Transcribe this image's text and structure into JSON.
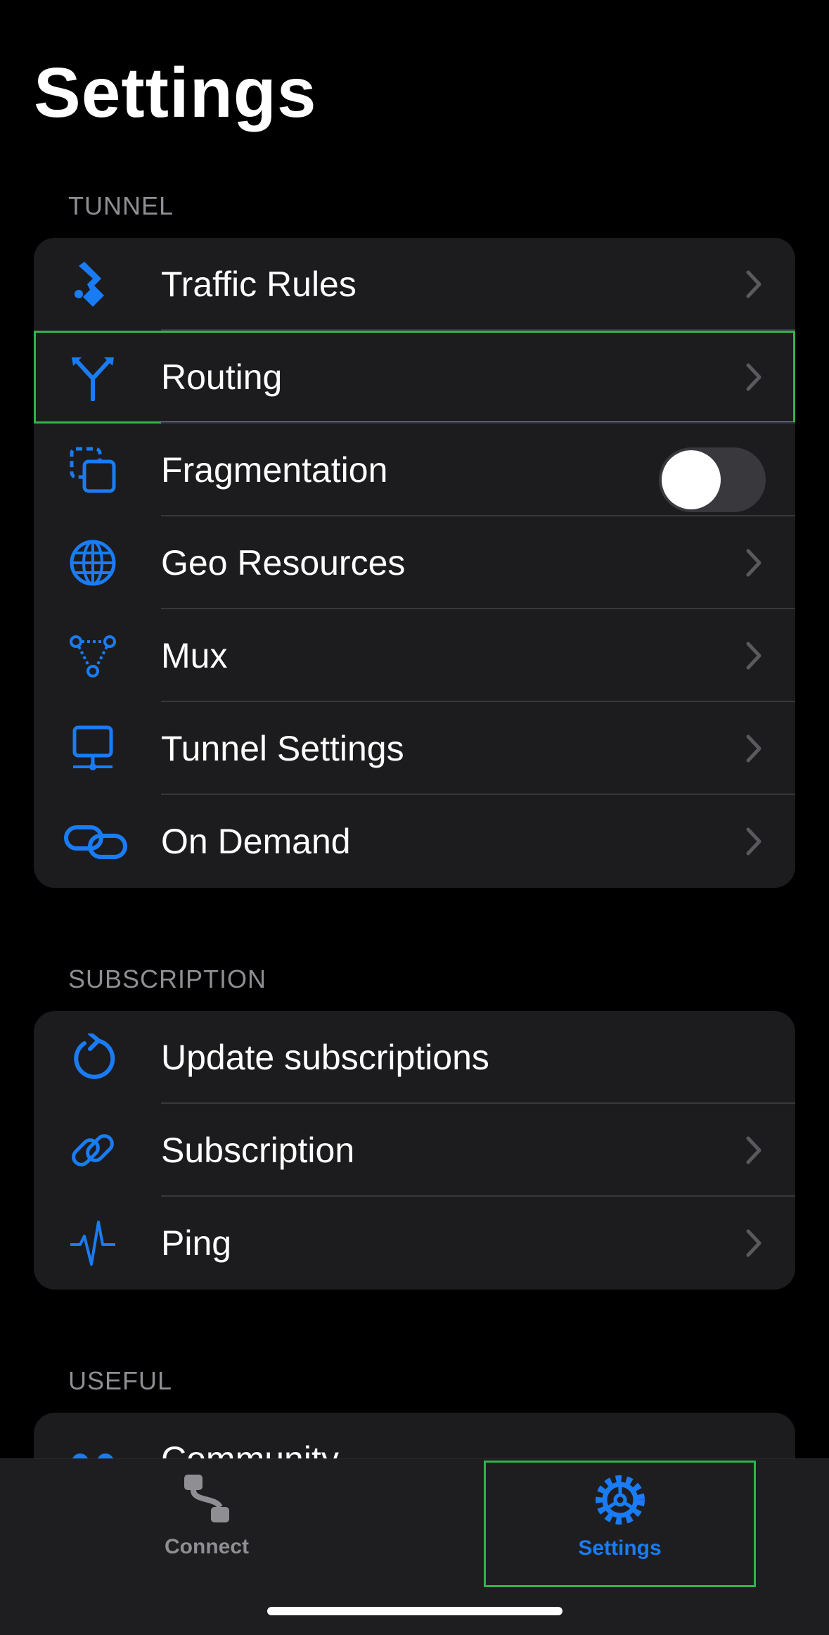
{
  "page": {
    "title": "Settings"
  },
  "sections": {
    "tunnel": {
      "header": "TUNNEL",
      "items": [
        {
          "label": "Traffic Rules",
          "icon": "traffic-rules-icon"
        },
        {
          "label": "Routing",
          "icon": "routing-icon"
        },
        {
          "label": "Fragmentation",
          "icon": "fragmentation-icon",
          "toggle": false
        },
        {
          "label": "Geo Resources",
          "icon": "globe-icon"
        },
        {
          "label": "Mux",
          "icon": "mux-icon"
        },
        {
          "label": "Tunnel Settings",
          "icon": "desktop-icon"
        },
        {
          "label": "On Demand",
          "icon": "link-icon"
        }
      ]
    },
    "subscription": {
      "header": "SUBSCRIPTION",
      "items": [
        {
          "label": "Update subscriptions",
          "icon": "refresh-icon"
        },
        {
          "label": "Subscription",
          "icon": "chain-link-icon"
        },
        {
          "label": "Ping",
          "icon": "waveform-icon"
        }
      ]
    },
    "useful": {
      "header": "USEFUL",
      "items": [
        {
          "label": "Community",
          "icon": "community-icon"
        }
      ]
    }
  },
  "tabbar": {
    "tabs": [
      {
        "label": "Connect",
        "icon": "connect-icon",
        "selected": false
      },
      {
        "label": "Settings",
        "icon": "gear-icon",
        "selected": true
      }
    ]
  },
  "colors": {
    "accent": "#1a7cf5",
    "background": "#000000",
    "group_background": "#1c1c1e",
    "secondary_text": "#8e8e93",
    "highlight": "#2fb44b"
  }
}
